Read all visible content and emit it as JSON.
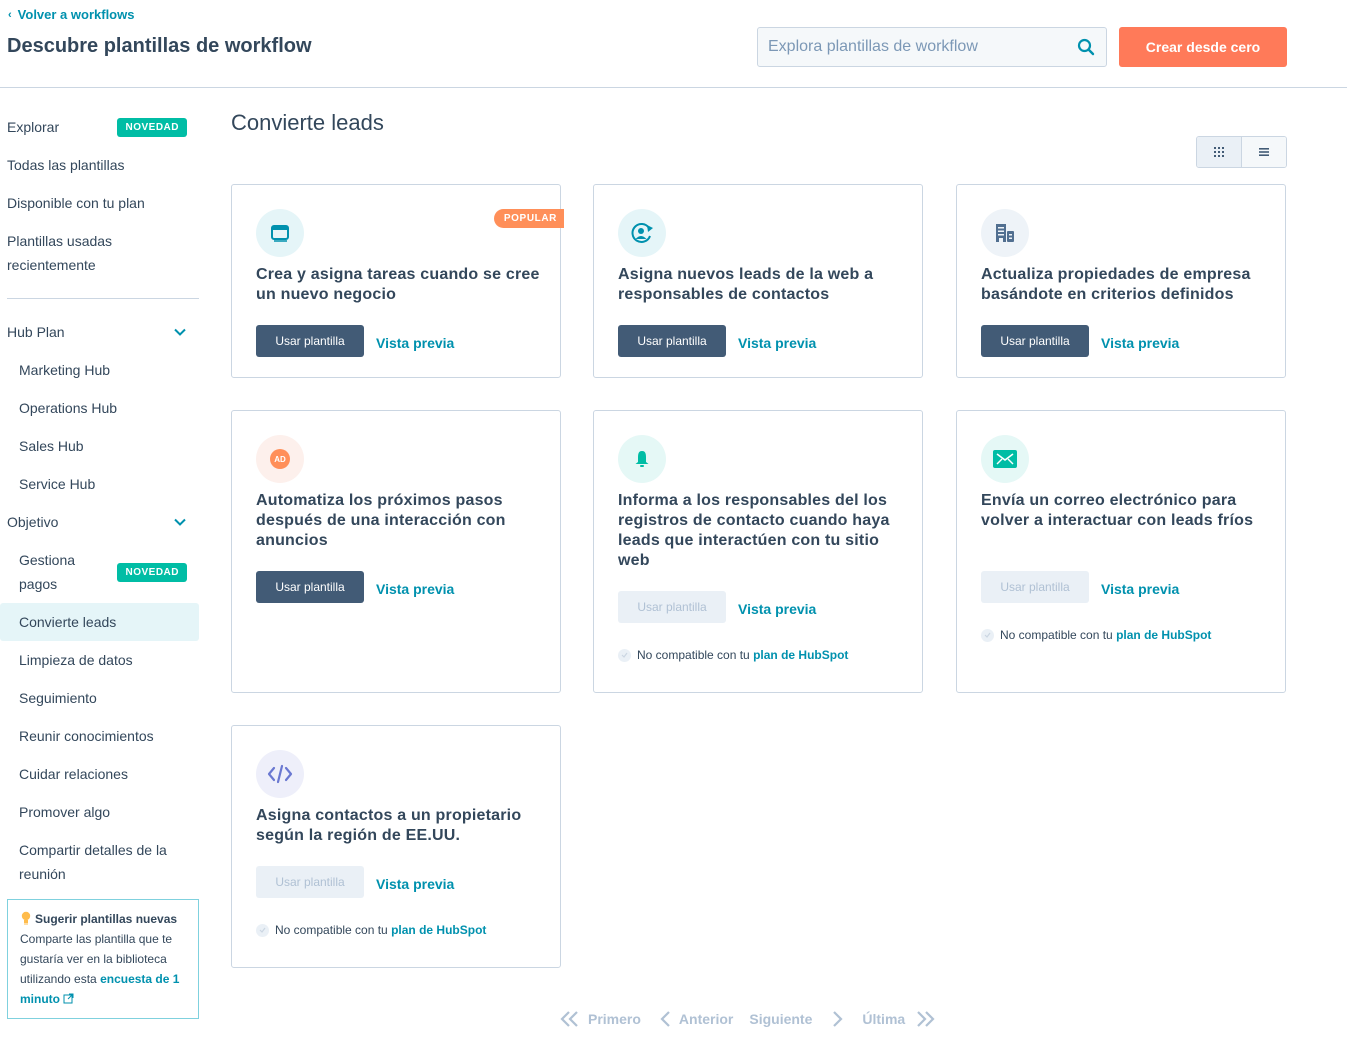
{
  "header": {
    "back_link": "Volver a workflows",
    "title": "Descubre plantillas de workflow",
    "search_placeholder": "Explora plantillas de workflow",
    "search_value": "",
    "create_button": "Crear desde cero"
  },
  "sidebar": {
    "top_items": [
      {
        "label": "Explorar",
        "badge": "NOVEDAD"
      },
      {
        "label": "Todas las plantillas"
      },
      {
        "label": "Disponible con tu plan"
      },
      {
        "label": "Plantillas usadas recientemente"
      }
    ],
    "hub_plan": {
      "label": "Hub Plan",
      "items": [
        "Marketing Hub",
        "Operations Hub",
        "Sales Hub",
        "Service Hub"
      ]
    },
    "objetivo": {
      "label": "Objetivo",
      "items": [
        {
          "label": "Gestiona pagos",
          "badge": "NOVEDAD"
        },
        {
          "label": "Convierte leads",
          "active": true
        },
        {
          "label": "Limpieza de datos"
        },
        {
          "label": "Seguimiento"
        },
        {
          "label": "Reunir conocimientos"
        },
        {
          "label": "Cuidar relaciones"
        },
        {
          "label": "Promover algo"
        },
        {
          "label": "Compartir detalles de la reunión"
        }
      ]
    },
    "suggest": {
      "title": "Sugerir plantillas nuevas",
      "text": "Comparte las plantilla que te gustaría ver en la biblioteca utilizando esta",
      "link": "encuesta de 1 minuto"
    }
  },
  "main": {
    "section_title": "Convierte leads",
    "view_options": [
      "grid",
      "list"
    ],
    "active_view": "grid",
    "cards": [
      {
        "title": "Crea y asigna tareas cuando se cree un nuevo negocio",
        "icon": "calendar-icon",
        "badge": "POPULAR",
        "use_label": "Usar plantilla",
        "preview_label": "Vista previa",
        "enabled": true
      },
      {
        "title": "Asigna nuevos leads de la web a responsables de contactos",
        "icon": "contact-rotate-icon",
        "use_label": "Usar plantilla",
        "preview_label": "Vista previa",
        "enabled": true
      },
      {
        "title": "Actualiza propiedades de empresa basándote en criterios definidos",
        "icon": "building-icon",
        "use_label": "Usar plantilla",
        "preview_label": "Vista previa",
        "enabled": true
      },
      {
        "title": "Automatiza los próximos pasos después de una interacción con anuncios",
        "icon": "ad-icon",
        "icon_text": "AD",
        "use_label": "Usar plantilla",
        "preview_label": "Vista previa",
        "enabled": true
      },
      {
        "title": "Informa a los responsables del los registros de contacto cuando haya leads que interactúen con tu sitio web",
        "icon": "bell-icon",
        "use_label": "Usar plantilla",
        "preview_label": "Vista previa",
        "enabled": false,
        "incompat_text": "No compatible con tu",
        "incompat_link": "plan de HubSpot"
      },
      {
        "title": "Envía un correo electrónico para volver a interactuar con leads fríos",
        "icon": "envelope-icon",
        "use_label": "Usar plantilla",
        "preview_label": "Vista previa",
        "enabled": false,
        "incompat_text": "No compatible con tu",
        "incompat_link": "plan de HubSpot"
      },
      {
        "title": "Asigna contactos a un propietario según la región de EE.UU.",
        "icon": "code-icon",
        "use_label": "Usar plantilla",
        "preview_label": "Vista previa",
        "enabled": false,
        "incompat_text": "No compatible con tu",
        "incompat_link": "plan de HubSpot"
      }
    ]
  },
  "pagination": {
    "first": "Primero",
    "prev": "Anterior",
    "next": "Siguiente",
    "last": "Última"
  },
  "colors": {
    "accent_link": "#0091ae",
    "primary_cta": "#ff7a59",
    "novedad_badge": "#00bda5",
    "popular_badge": "#ff8f59",
    "dark_button": "#425b76",
    "text": "#33475b"
  }
}
